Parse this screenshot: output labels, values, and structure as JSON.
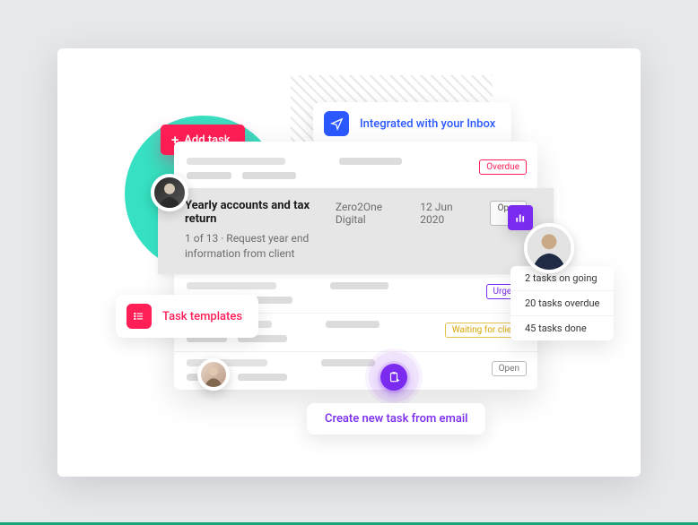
{
  "buttons": {
    "add_task": "Add task",
    "open": "Open"
  },
  "pills": {
    "inbox": "Integrated with your Inbox",
    "templates": "Task templates",
    "create_email": "Create new task from email"
  },
  "expanded_task": {
    "title": "Yearly accounts and tax return",
    "company": "Zero2One Digital",
    "date": "12 Jun 2020",
    "step": "1 of 13",
    "note": "Request year end information from client"
  },
  "tags": {
    "overdue": "Overdue",
    "open": "Open",
    "urgent": "Urgent",
    "waiting": "Waiting for client"
  },
  "stats": {
    "ongoing": "2 tasks on going",
    "overdue": "20 tasks overdue",
    "done": "45 tasks done"
  }
}
